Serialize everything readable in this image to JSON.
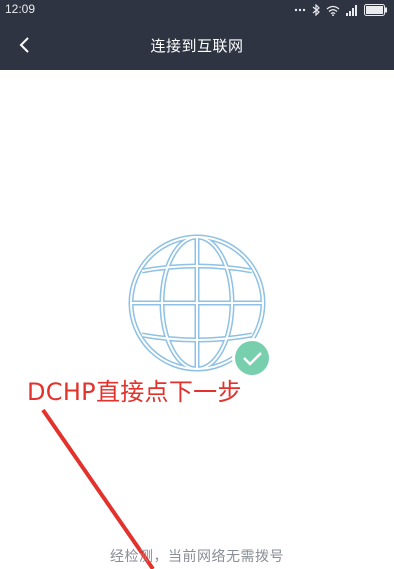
{
  "status_bar": {
    "time": "12:09",
    "icons": [
      "signal-dots-icon",
      "bluetooth-icon",
      "wifi-icon",
      "cellular-icon",
      "battery-icon"
    ]
  },
  "nav": {
    "back_icon": "chevron-left-icon",
    "title": "连接到互联网"
  },
  "main": {
    "globe_icon": "globe-icon",
    "check_icon": "checkmark-badge-icon",
    "annotation": "DCHP直接点下一步",
    "detect_text": "经检测，当前网络无需拨号"
  },
  "colors": {
    "header_bg": "#2f3442",
    "globe_stroke": "#8ec1e4",
    "check_bg": "#78cfae",
    "annotation": "#e3322c",
    "muted_text": "#8a8e96"
  }
}
